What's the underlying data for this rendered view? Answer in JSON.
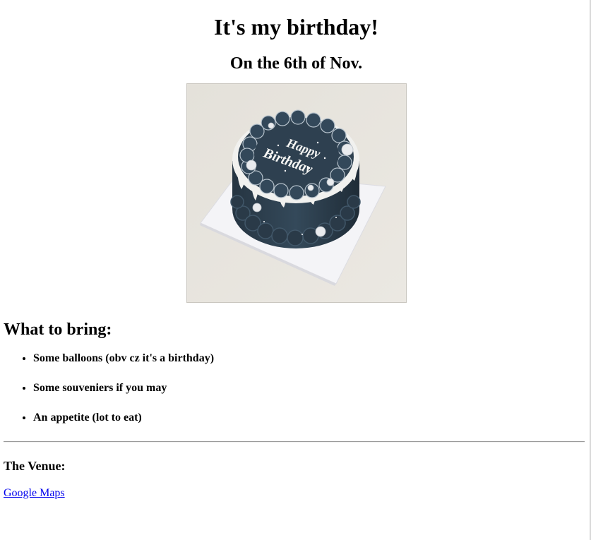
{
  "invite": {
    "title": "It's my birthday!",
    "date": "On the 6th of Nov."
  },
  "cake_image": {
    "inscription_line1": "Happy",
    "inscription_line2": "Birthday",
    "colors": {
      "background": "#e8e5df",
      "board": "#f3f3f5",
      "frosting": "#2f4150",
      "icing": "#f1f1ef"
    }
  },
  "bring": {
    "heading": "What to bring:",
    "items": [
      "Some balloons (obv cz it's a birthday)",
      "Some souveniers if you may",
      "An appetite (lot to eat)"
    ]
  },
  "venue": {
    "heading": "The Venue:",
    "link_label": "Google Maps",
    "link_color": "#0000ee"
  }
}
